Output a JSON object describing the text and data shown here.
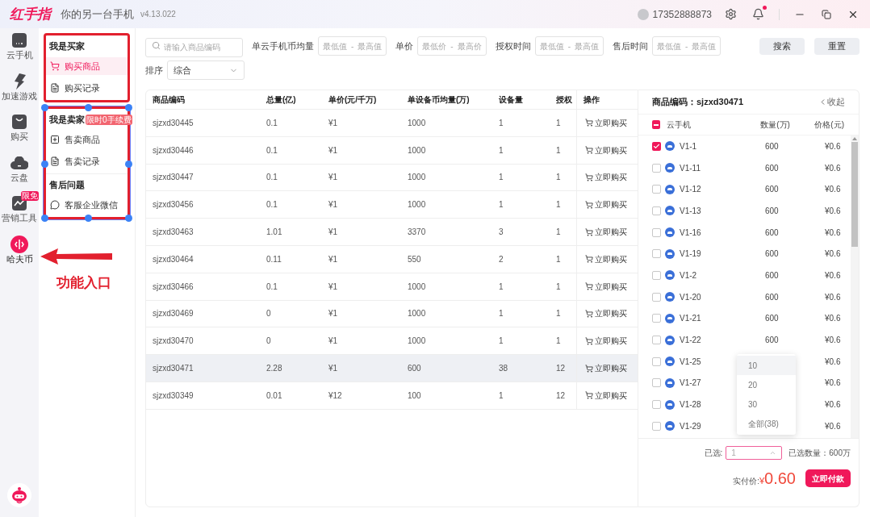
{
  "app": {
    "logo": "红手指",
    "tagline": "你的另一台手机",
    "version": "v4.13.022",
    "phone": "17352888873",
    "notification": true
  },
  "rail": [
    {
      "label": "云手机",
      "kind": "phone",
      "selected": false
    },
    {
      "label": "加速游戏",
      "kind": "bolt",
      "selected": false
    },
    {
      "label": "购买",
      "kind": "bag",
      "selected": false
    },
    {
      "label": "云盘",
      "kind": "cloud",
      "selected": false
    },
    {
      "label": "营销工具",
      "kind": "chart",
      "badge": "限免",
      "selected": false
    },
    {
      "label": "哈夫币",
      "kind": "coin",
      "selected": true
    }
  ],
  "menu_groups": [
    {
      "handles": false,
      "sections": [
        {
          "title": "我是买家",
          "items": [
            {
              "label": "购买商品",
              "kind": "cart",
              "selected": true
            },
            {
              "label": "购买记录",
              "kind": "doc",
              "selected": false
            }
          ]
        }
      ]
    },
    {
      "handles": true,
      "sections": [
        {
          "title": "我是卖家",
          "badge": "限时0手续费",
          "items": [
            {
              "label": "售卖商品",
              "kind": "plus",
              "selected": false
            },
            {
              "label": "售卖记录",
              "kind": "doc",
              "selected": false
            }
          ]
        },
        {
          "title": "售后问题",
          "items": [
            {
              "label": "客服企业微信",
              "kind": "chat",
              "selected": false
            }
          ]
        }
      ]
    }
  ],
  "annotation": {
    "text": "功能入口"
  },
  "filters": {
    "search": {
      "placeholder": "请输入商品编码"
    },
    "ranges": [
      {
        "label": "单云手机币均量",
        "min": "最低值",
        "separator": "-",
        "max": "最高值"
      },
      {
        "label": "单价",
        "min": "最低价",
        "separator": "-",
        "max": "最高价"
      },
      {
        "label": "授权时间",
        "min": "最低值",
        "separator": "-",
        "max": "最高值"
      },
      {
        "label": "售后时间",
        "min": "最低值",
        "separator": "-",
        "max": "最高值"
      }
    ],
    "buttons": [
      "搜索",
      "重置"
    ],
    "sort_label": "排序",
    "sort_value": "综合"
  },
  "table": {
    "columns": [
      "商品编码",
      "总量(亿)",
      "单价(元/千万)",
      "单设备币均量(万)",
      "设备量",
      "授权",
      "操作"
    ],
    "rows": [
      {
        "cells": [
          "sjzxd30445",
          "0.1",
          "¥1",
          "1000",
          "1",
          "1"
        ],
        "action": "立即购买",
        "selected": false
      },
      {
        "cells": [
          "sjzxd30446",
          "0.1",
          "¥1",
          "1000",
          "1",
          "1"
        ],
        "action": "立即购买",
        "selected": false
      },
      {
        "cells": [
          "sjzxd30447",
          "0.1",
          "¥1",
          "1000",
          "1",
          "1"
        ],
        "action": "立即购买",
        "selected": false
      },
      {
        "cells": [
          "sjzxd30456",
          "0.1",
          "¥1",
          "1000",
          "1",
          "1"
        ],
        "action": "立即购买",
        "selected": false
      },
      {
        "cells": [
          "sjzxd30463",
          "1.01",
          "¥1",
          "3370",
          "3",
          "1"
        ],
        "action": "立即购买",
        "selected": false
      },
      {
        "cells": [
          "sjzxd30464",
          "0.11",
          "¥1",
          "550",
          "2",
          "1"
        ],
        "action": "立即购买",
        "selected": false
      },
      {
        "cells": [
          "sjzxd30466",
          "0.1",
          "¥1",
          "1000",
          "1",
          "1"
        ],
        "action": "立即购买",
        "selected": false
      },
      {
        "cells": [
          "sjzxd30469",
          "0",
          "¥1",
          "1000",
          "1",
          "1"
        ],
        "action": "立即购买",
        "selected": false
      },
      {
        "cells": [
          "sjzxd30470",
          "0",
          "¥1",
          "1000",
          "1",
          "1"
        ],
        "action": "立即购买",
        "selected": false
      },
      {
        "cells": [
          "sjzxd30471",
          "2.28",
          "¥1",
          "600",
          "38",
          "12"
        ],
        "action": "立即购买",
        "selected": true
      },
      {
        "cells": [
          "sjzxd30349",
          "0.01",
          "¥12",
          "100",
          "1",
          "12"
        ],
        "action": "立即购买",
        "selected": false
      }
    ]
  },
  "detail": {
    "title": "商品编码：sjzxd30471",
    "collapse": "收起",
    "columns": [
      "云手机",
      "数量(万)",
      "价格(元)"
    ],
    "header_indeterminate": true,
    "rows": [
      {
        "name": "V1-1",
        "qty": "600",
        "price": "¥0.6",
        "checked": true
      },
      {
        "name": "V1-11",
        "qty": "600",
        "price": "¥0.6",
        "checked": false
      },
      {
        "name": "V1-12",
        "qty": "600",
        "price": "¥0.6",
        "checked": false
      },
      {
        "name": "V1-13",
        "qty": "600",
        "price": "¥0.6",
        "checked": false
      },
      {
        "name": "V1-16",
        "qty": "600",
        "price": "¥0.6",
        "checked": false
      },
      {
        "name": "V1-19",
        "qty": "600",
        "price": "¥0.6",
        "checked": false
      },
      {
        "name": "V1-2",
        "qty": "600",
        "price": "¥0.6",
        "checked": false
      },
      {
        "name": "V1-20",
        "qty": "600",
        "price": "¥0.6",
        "checked": false
      },
      {
        "name": "V1-21",
        "qty": "600",
        "price": "¥0.6",
        "checked": false
      },
      {
        "name": "V1-22",
        "qty": "600",
        "price": "¥0.6",
        "checked": false
      },
      {
        "name": "V1-25",
        "price": "¥0.6",
        "checked": false
      },
      {
        "name": "V1-27",
        "price": "¥0.6",
        "checked": false
      },
      {
        "name": "V1-28",
        "price": "¥0.6",
        "checked": false
      },
      {
        "name": "V1-29",
        "price": "¥0.6",
        "checked": false
      }
    ],
    "dropdown": [
      {
        "label": "10",
        "selected": true
      },
      {
        "label": "20",
        "selected": false
      },
      {
        "label": "30",
        "selected": false
      },
      {
        "label": "全部(38)",
        "selected": false
      }
    ],
    "selected_label": "已选:",
    "select_value": "1",
    "selected_count": "已选数量：600万",
    "pay_label": "实付价:",
    "currency": "¥",
    "amount": "0.60",
    "pay_button": "立即付款"
  }
}
